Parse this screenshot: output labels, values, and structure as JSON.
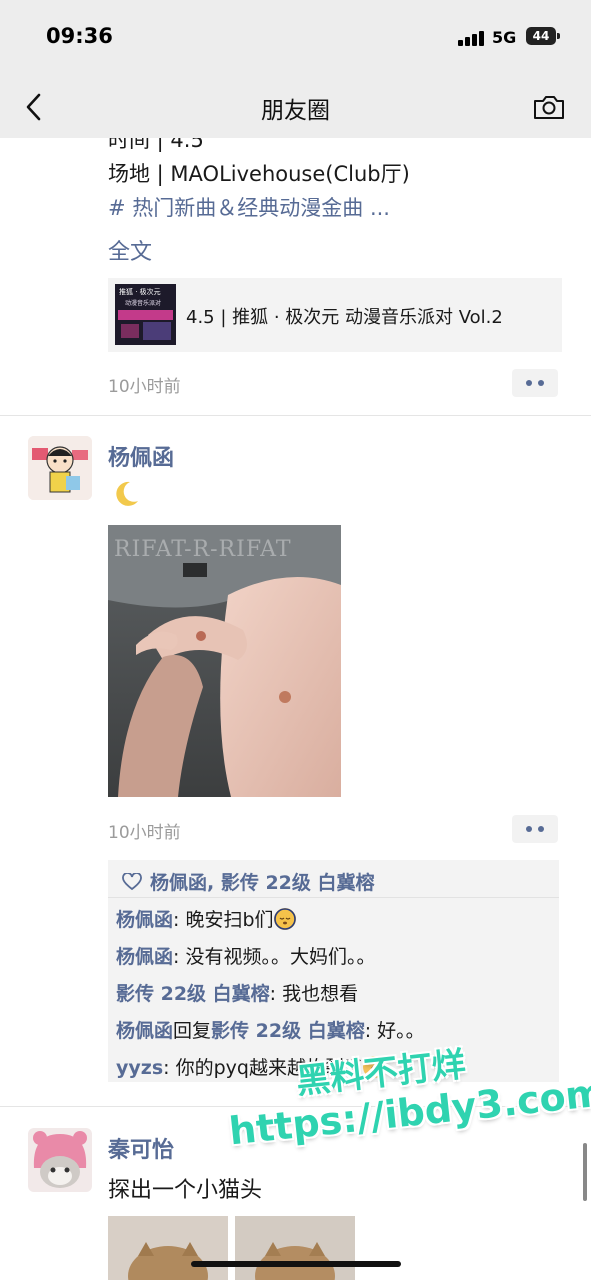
{
  "status": {
    "time": "09:36",
    "network": "5G",
    "battery": "44"
  },
  "nav": {
    "title": "朋友圈",
    "back_icon": "chevron-left-icon",
    "camera_icon": "camera-icon"
  },
  "post1": {
    "line_partial": "时间 | 4.5",
    "line_venue": "场地 | MAOLivehouse(Club厅)",
    "line_tags": "# 热门新曲＆经典动漫金曲 ...",
    "full_text": "全文",
    "link_title": "4.5 | 推狐 · 极次元 动漫音乐派对 Vol.2",
    "thumb_text1": "推狐 · 极次元",
    "thumb_text2": "动漫音乐派对",
    "time": "10小时前"
  },
  "post2": {
    "author": "杨佩函",
    "text_icon": "crescent-moon-icon",
    "photo_caption": "RIFAT-R-RIFAT",
    "time": "10小时前",
    "likes": "杨佩函, 影传 22级 白冀榕",
    "comments": [
      {
        "name": "杨佩函",
        "sep": ": ",
        "text": "晚安扫b们",
        "emoji": "sleeping-emoji"
      },
      {
        "name": "杨佩函",
        "sep": ": ",
        "text": "没有视频。。大妈们。。"
      },
      {
        "name": "影传 22级 白冀榕",
        "sep": ": ",
        "text": "我也想看"
      },
      {
        "name": "杨佩函",
        "reply_word": "回复",
        "reply_to": "影传 22级 白冀榕",
        "sep": ": ",
        "text": "好。。"
      },
      {
        "name": "yyzs",
        "sep": ": ",
        "text": "你的pyq越来越炸裂了",
        "emoji": "yawning-emoji"
      }
    ]
  },
  "post3": {
    "author": "秦可怡",
    "text": "探出一个小猫头"
  },
  "watermark": {
    "line1": "黑料不打烊",
    "line2": "https://ibdy3.com"
  },
  "colors": {
    "link_blue": "#576b95",
    "bar_bg": "#ededed",
    "watermark": "#2fd3b0"
  }
}
